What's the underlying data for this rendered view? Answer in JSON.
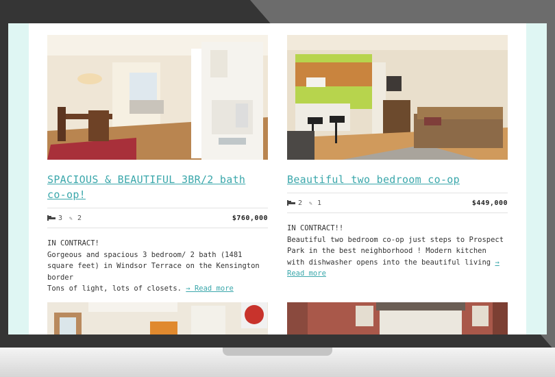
{
  "listings": [
    {
      "title": "SPACIOUS & BEAUTIFUL 3BR/2 bath co-op!",
      "beds": "3",
      "baths": "2",
      "price": "$760,000",
      "status": "IN CONTRACT!",
      "description": "Gorgeous and spacious 3 bedroom/ 2 bath (1481 square feet) in Windsor Terrace on the Kensington border",
      "description2": "Tons of light, lots of closets.",
      "read_more": "→ Read more"
    },
    {
      "title": "Beautiful two bedroom co-op",
      "beds": "2",
      "baths": "1",
      "price": "$449,000",
      "status": "IN CONTRACT!!",
      "description": "Beautiful two bedroom co-op just steps to Prospect Park in the best neighborhood ! Modern kitchen with dishwasher opens into the beautiful living",
      "read_more": "→ Read more"
    }
  ],
  "icons": {
    "bed": "bed-icon",
    "bath": "bath-icon"
  },
  "colors": {
    "accent": "#3aa7ab",
    "screen_bg": "#dff6f3",
    "bezel": "#353535"
  }
}
